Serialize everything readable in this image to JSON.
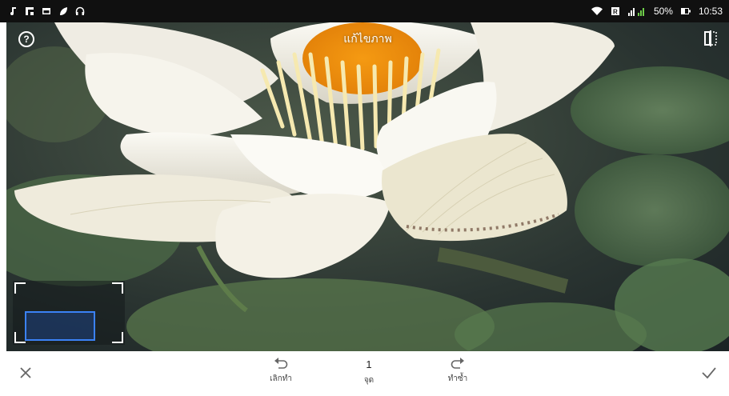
{
  "status_bar": {
    "left_icons": [
      "music-note-icon",
      "flipboard-icon",
      "gallery-icon",
      "leaf-icon",
      "headphones-icon"
    ],
    "right_icons": [
      "wifi-icon",
      "data-icon",
      "signal-icon",
      "battery-icon"
    ],
    "battery": "50%",
    "time": "10:53"
  },
  "editor": {
    "title": "แก้ไขภาพ",
    "help_icon": "help-icon",
    "compare_icon": "compare-icon"
  },
  "toolbar": {
    "close_icon": "close-icon",
    "undo_label": "เลิกทำ",
    "count_value": "1",
    "count_label": "จุด",
    "redo_label": "ทำซ้ำ",
    "done_icon": "check-icon"
  },
  "colors": {
    "status_bar_bg": "#101010",
    "accent_blue": "#3b82f6",
    "toolbar_bg": "#ffffff",
    "icon_gray": "#666666"
  }
}
